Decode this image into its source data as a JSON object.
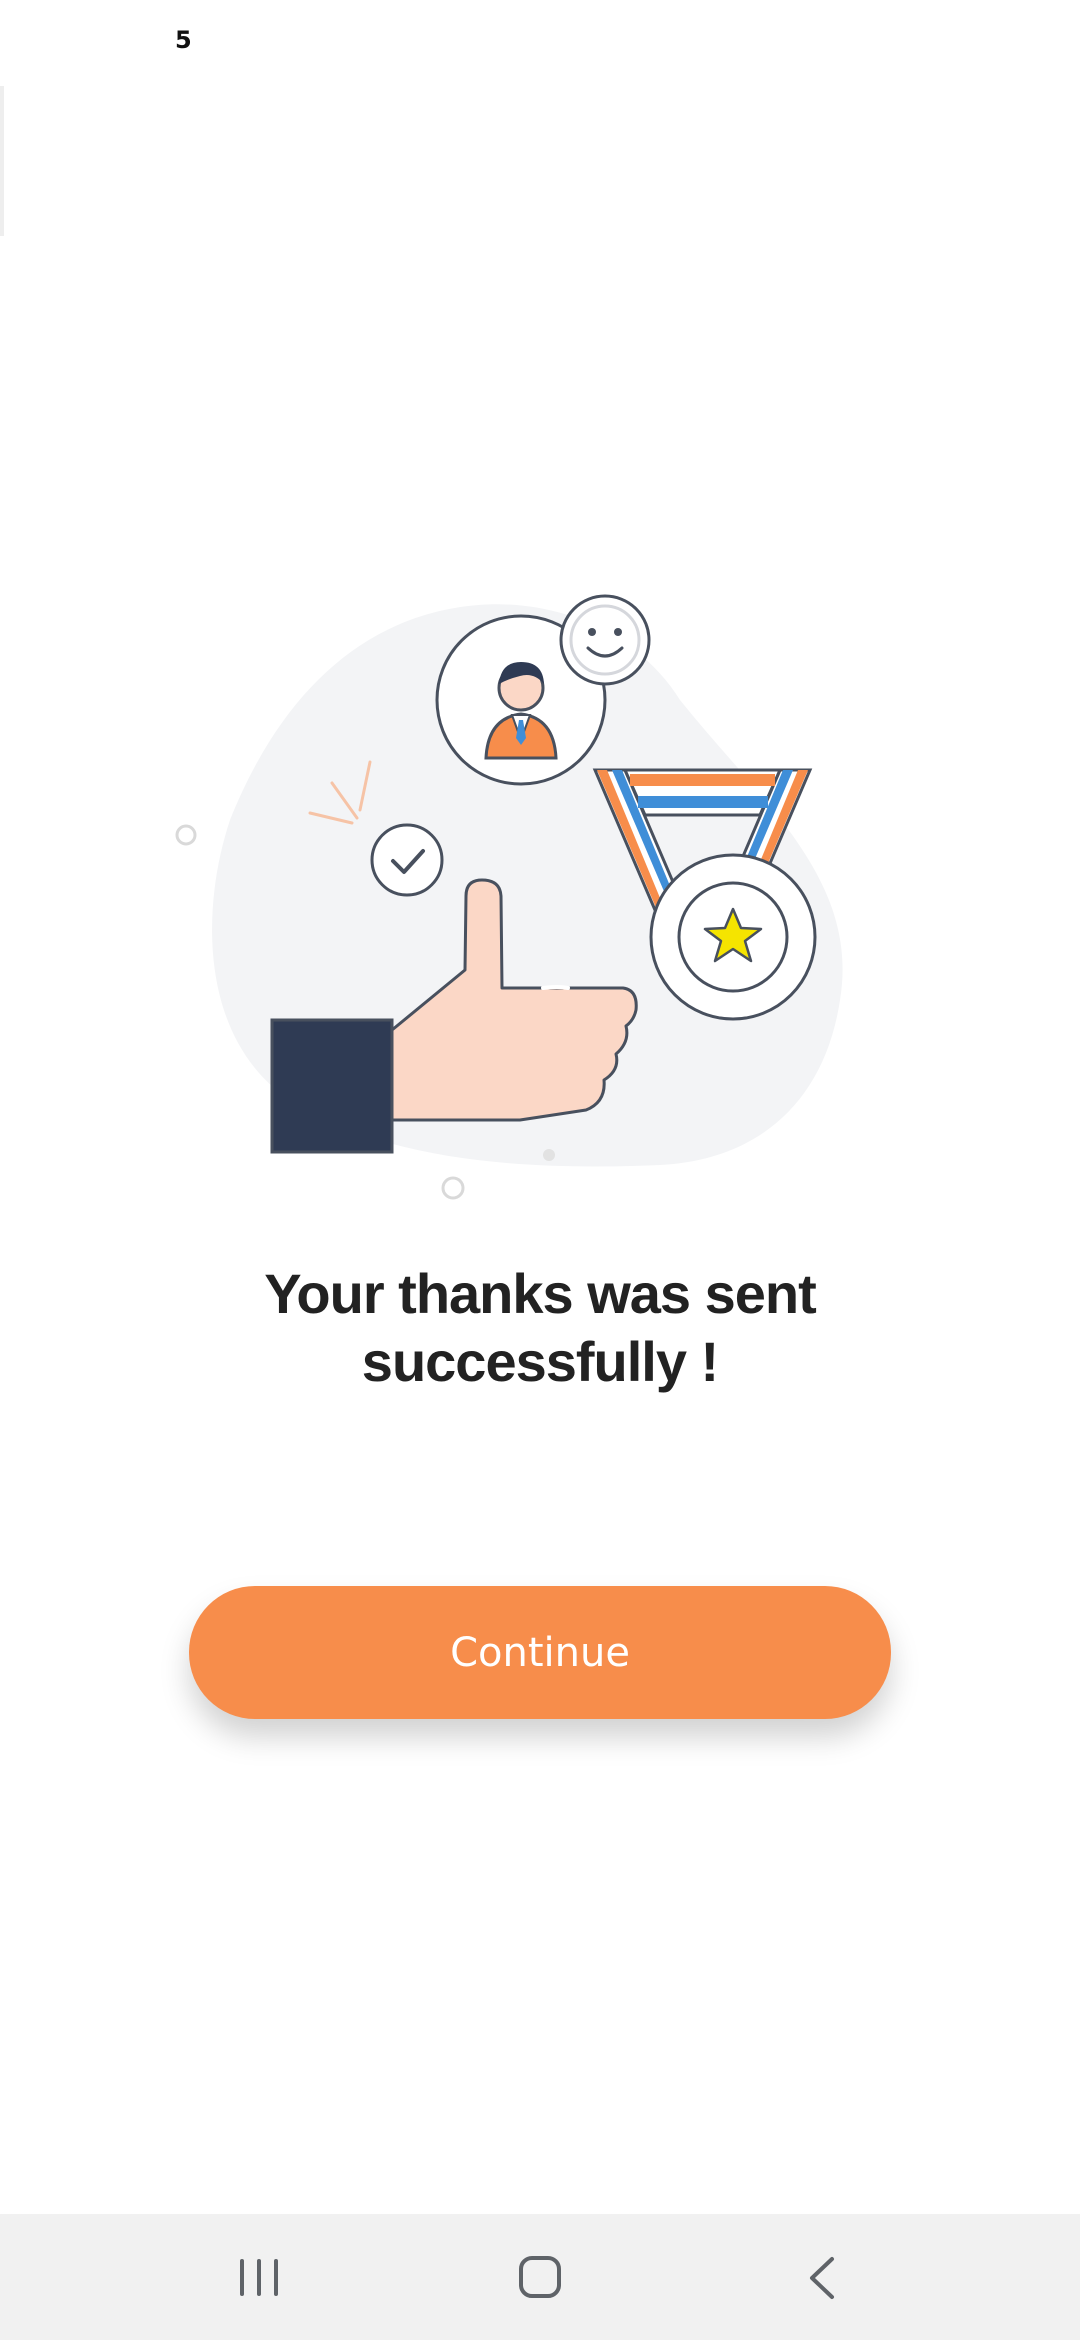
{
  "status_bar": {
    "indicator": "5"
  },
  "illustration": {
    "icons": [
      "thumbs-up-icon",
      "user-avatar-icon",
      "smiley-icon",
      "check-circle-icon",
      "medal-icon",
      "star-icon"
    ]
  },
  "message": {
    "line1": "Your thanks was sent",
    "line2": "successfully !"
  },
  "continue_button": {
    "label": "Continue"
  },
  "nav_bar": {
    "icons": [
      "recent-apps-icon",
      "home-icon",
      "back-icon"
    ]
  },
  "colors": {
    "accent": "#f78d4b",
    "text": "#222222",
    "nav_background": "#f1f1f1",
    "sleeve": "#2f3b54",
    "skin": "#fbd7c6",
    "medal_blue": "#3f8ed8",
    "star_yellow": "#f5e400"
  }
}
